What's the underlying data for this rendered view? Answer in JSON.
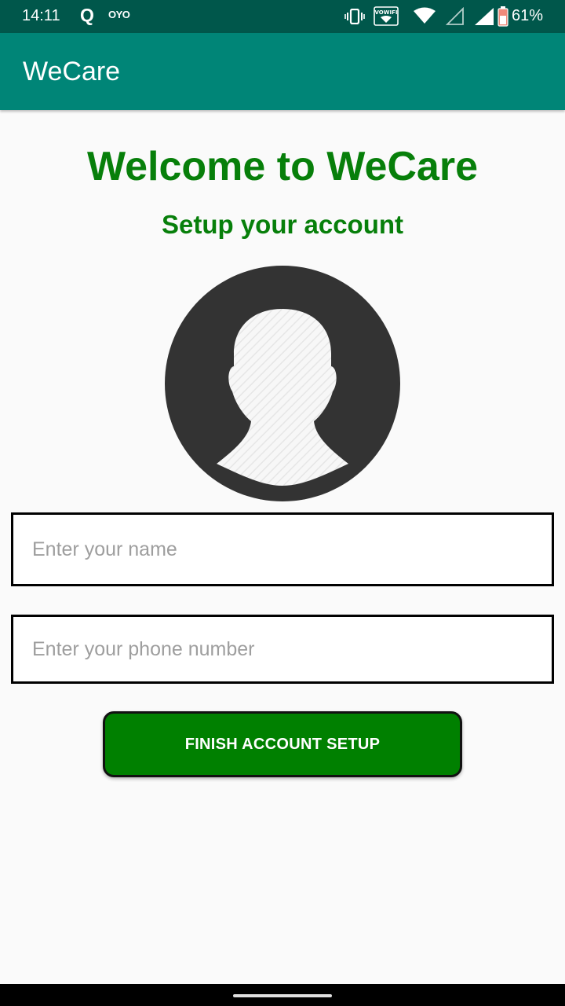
{
  "status_bar": {
    "time": "14:11",
    "left_icons": [
      "q-icon",
      "oyo-icon"
    ],
    "q_glyph": "Q",
    "oyo_text": "OYO",
    "vowifi_label": "VOWIFI",
    "right_icons": [
      "vibrate-icon",
      "vowifi-icon",
      "wifi-icon",
      "signal-empty-icon",
      "signal-full-icon",
      "battery-icon"
    ],
    "battery_percent": "61%"
  },
  "app_bar": {
    "title": "WeCare"
  },
  "main": {
    "heading": "Welcome to WeCare",
    "subheading": "Setup your account",
    "avatar_icon": "profile-placeholder-icon",
    "name_input": {
      "placeholder": "Enter your name",
      "value": ""
    },
    "phone_input": {
      "placeholder": "Enter your phone number",
      "value": ""
    },
    "finish_button": "FINISH ACCOUNT SETUP"
  },
  "colors": {
    "status_bar": "#00574b",
    "app_bar": "#008577",
    "heading_green": "#077f0a",
    "button_green": "#008000",
    "avatar_dark": "#333333"
  }
}
